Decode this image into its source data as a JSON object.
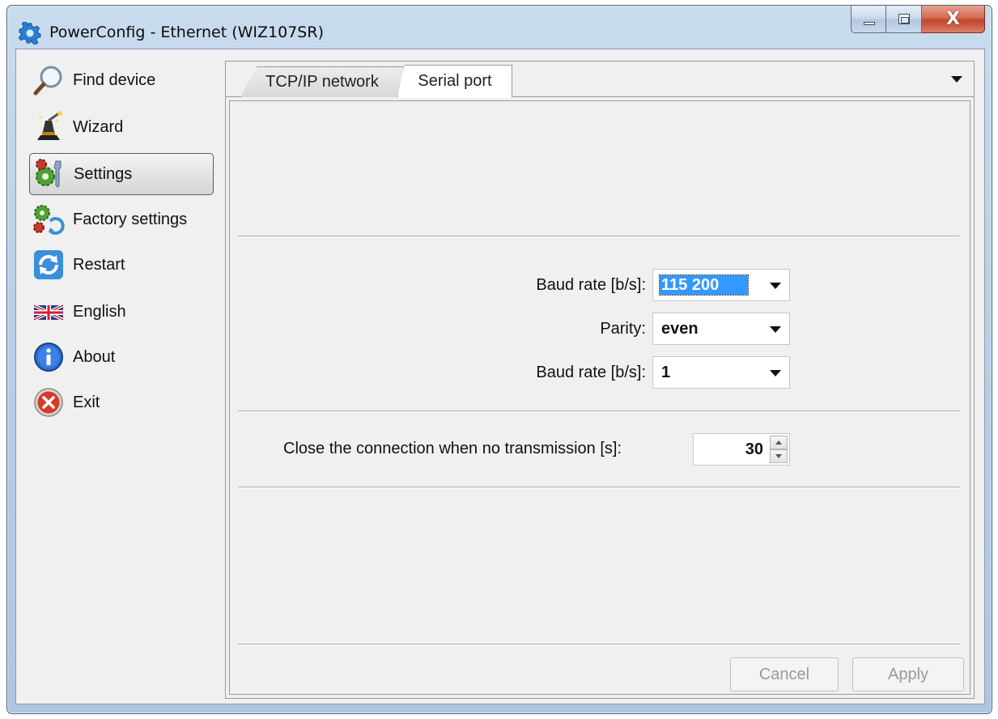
{
  "window": {
    "title": "PowerConfig - Ethernet (WIZ107SR)",
    "close_glyph": "X"
  },
  "sidebar": {
    "items": [
      {
        "label": "Find device",
        "icon": "magnifier-icon"
      },
      {
        "label": "Wizard",
        "icon": "wizard-hat-icon"
      },
      {
        "label": "Settings",
        "icon": "settings-gears-icon",
        "selected": true
      },
      {
        "label": "Factory settings",
        "icon": "factory-gears-icon"
      },
      {
        "label": "Restart",
        "icon": "refresh-icon"
      },
      {
        "label": "English",
        "icon": "uk-flag-icon"
      },
      {
        "label": "About",
        "icon": "info-icon"
      },
      {
        "label": "Exit",
        "icon": "exit-icon"
      }
    ]
  },
  "tabs": [
    {
      "label": "TCP/IP network",
      "active": false
    },
    {
      "label": "Serial port",
      "active": true
    }
  ],
  "serial": {
    "baud_label": "Baud rate [b/s]:",
    "baud_value": "115 200",
    "parity_label": "Parity:",
    "parity_value": "even",
    "stop_label": "Baud rate [b/s]:",
    "stop_value": "1",
    "timeout_label": "Close the connection when no transmission [s]:",
    "timeout_value": "30"
  },
  "buttons": {
    "cancel": "Cancel",
    "apply": "Apply"
  },
  "colors": {
    "selection": "#3399ff",
    "close_button": "#c2452b"
  }
}
